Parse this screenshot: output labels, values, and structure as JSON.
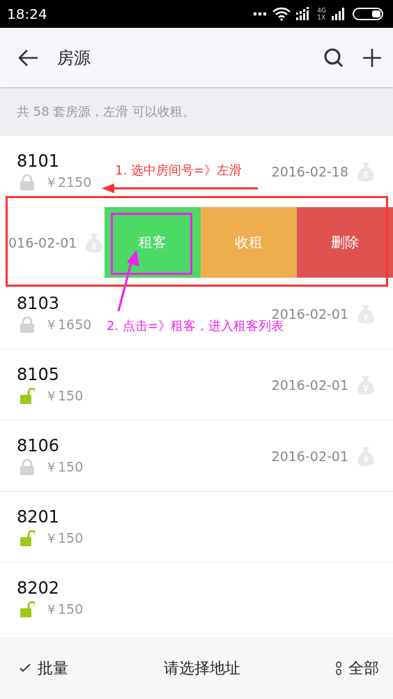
{
  "status_bar": {
    "time": "18:24",
    "network_top": "4G",
    "network_bottom": "1X"
  },
  "header": {
    "title": "房源"
  },
  "summary": "共 58 套房源，左滑 可以收租。",
  "rows": [
    {
      "kind": "room",
      "number": "8101",
      "locked": true,
      "price": "￥2150",
      "date": "2016-02-18"
    },
    {
      "kind": "swiped",
      "date": "016-02-01",
      "actions": [
        {
          "label": "租客",
          "color": "#4cd964"
        },
        {
          "label": "收租",
          "color": "#eeae50"
        },
        {
          "label": "删除",
          "color": "#de5350"
        }
      ]
    },
    {
      "kind": "room",
      "number": "8103",
      "locked": true,
      "price": "￥1650",
      "date": "2016-02-01"
    },
    {
      "kind": "room",
      "number": "8105",
      "locked": false,
      "price": "￥150",
      "date": "2016-02-01"
    },
    {
      "kind": "room",
      "number": "8106",
      "locked": true,
      "price": "￥150",
      "date": "2016-02-01"
    },
    {
      "kind": "room",
      "number": "8201",
      "locked": false,
      "price": "￥150"
    },
    {
      "kind": "room",
      "number": "8202",
      "locked": false,
      "price": "￥150"
    }
  ],
  "bottom_bar": {
    "batch": "批量",
    "address": "请选择地址",
    "filter": "全部"
  },
  "annotations": [
    {
      "kind": "swipe",
      "text": "1. 选中房间号=》左滑",
      "color": "#ff3333"
    },
    {
      "kind": "tap",
      "text": "2. 点击=》租客，进入租客列表",
      "color": "#ee22ee"
    }
  ]
}
